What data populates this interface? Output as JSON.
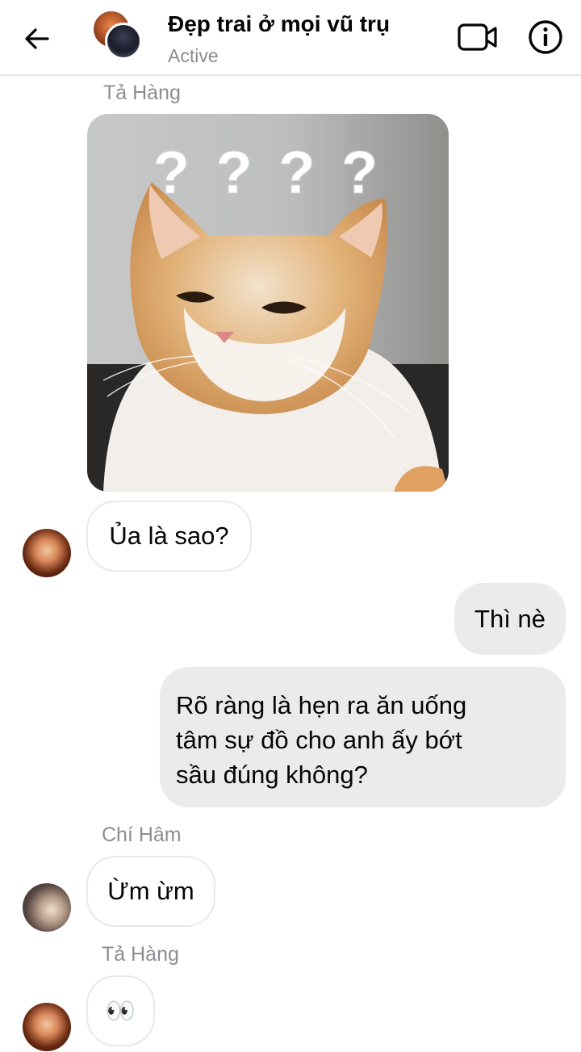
{
  "header": {
    "title": "Đẹp trai ở mọi vũ trụ",
    "status": "Active",
    "icons": [
      "back-arrow-icon",
      "video-call-icon",
      "info-icon"
    ]
  },
  "image_message": {
    "sender": "Tả Hàng",
    "overlay_text": "? ? ? ?"
  },
  "messages": [
    {
      "text": "Ủa là sao?"
    },
    {
      "text": "Thì nè"
    },
    {
      "lines": [
        "Rõ ràng là hẹn ra ăn uống",
        "tâm sự đồ cho anh ấy bớt",
        "sầu đúng không?"
      ]
    },
    {
      "sender": "Chí Hâm",
      "text": "Ừm ừm"
    },
    {
      "sender": "Tả Hàng",
      "text": "👀"
    }
  ]
}
